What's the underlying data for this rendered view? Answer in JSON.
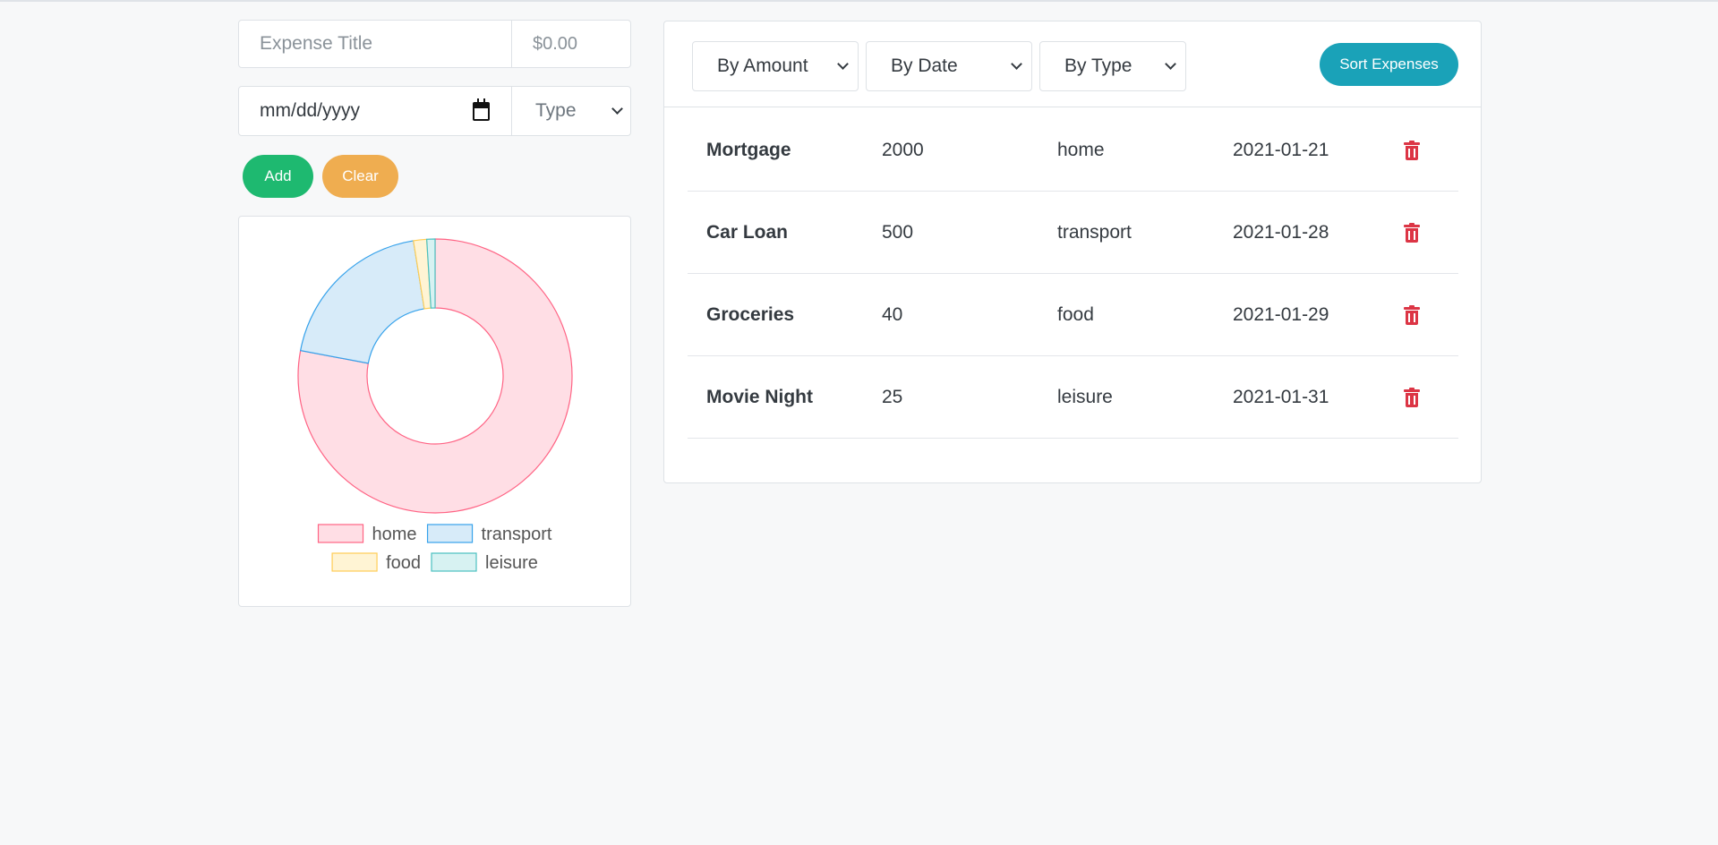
{
  "form": {
    "title_placeholder": "Expense Title",
    "amount_placeholder": "$0.00",
    "date_placeholder": "mm/dd/yyyy",
    "type_select_value": "Type",
    "add_label": "Add",
    "clear_label": "Clear"
  },
  "toolbar": {
    "sort_amount_value": "By Amount",
    "sort_date_value": "By Date",
    "sort_type_value": "By Type",
    "sort_button_label": "Sort Expenses"
  },
  "expenses": [
    {
      "title": "Mortgage",
      "amount": "2000",
      "type": "home",
      "date": "2021-01-21"
    },
    {
      "title": "Car Loan",
      "amount": "500",
      "type": "transport",
      "date": "2021-01-28"
    },
    {
      "title": "Groceries",
      "amount": "40",
      "type": "food",
      "date": "2021-01-29"
    },
    {
      "title": "Movie Night",
      "amount": "25",
      "type": "leisure",
      "date": "2021-01-31"
    }
  ],
  "colors": {
    "add_button": "#1eb970",
    "clear_button": "#efad50",
    "sort_button": "#1aa2b8",
    "delete_icon": "#dc3545"
  },
  "chart_data": {
    "type": "pie",
    "variant": "doughnut",
    "categories": [
      "home",
      "transport",
      "food",
      "leisure"
    ],
    "values": [
      2000,
      500,
      40,
      25
    ],
    "fill_colors": [
      "#ffdee5",
      "#d7ebf9",
      "#fff4d4",
      "#d7f2f2"
    ],
    "border_colors": [
      "#ff6384",
      "#36a2eb",
      "#ffcd56",
      "#4bc0c0"
    ],
    "legend_position": "bottom"
  }
}
